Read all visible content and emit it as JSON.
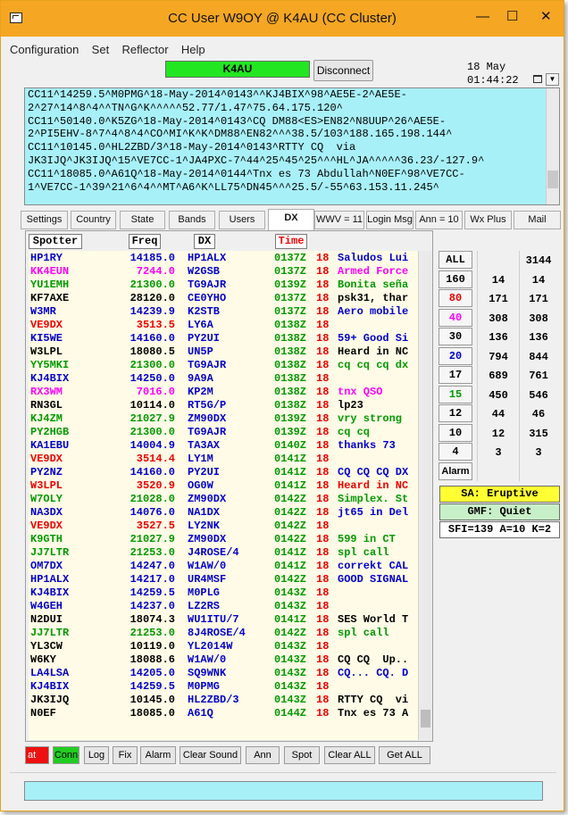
{
  "window": {
    "title": "CC User W9OY @ K4AU  (CC Cluster)",
    "controls": {
      "minimize": "—",
      "maximize": "☐",
      "close": "✕"
    }
  },
  "menu": [
    "Configuration",
    "Set",
    "Reflector",
    "Help"
  ],
  "cluster": {
    "node": "K4AU",
    "node_color": "#22e622",
    "disconnect_label": "Disconnect",
    "date": "18 May",
    "time": "01:44:22"
  },
  "raw_lines": [
    "CC11^14259.5^M0PMG^18-May-2014^0143^^KJ4BIX^98^AE5E-2^AE5E-",
    "2^27^14^8^4^^TN^G^K^^^^^52.77/1.47^75.64.175.120^",
    "CC11^50140.0^K5ZG^18-May-2014^0143^CQ DM88<ES>EN82^N8UUP^26^AE5E-",
    "2^PI5EHV-8^7^4^8^4^CO^MI^K^K^DM88^EN82^^^38.5/103^188.165.198.144^",
    "CC11^10145.0^HL2ZBD/3^18-May-2014^0143^RTTY CQ  via",
    "JK3IJQ^JK3IJQ^15^VE7CC-1^JA4PXC-7^44^25^45^25^^^HL^JA^^^^^36.23/-127.9^",
    "CC11^18085.0^A61Q^18-May-2014^0144^Tnx es 73 Abdullah^N0EF^98^VE7CC-",
    "1^VE7CC-1^39^21^6^4^^MT^A6^K^LL75^DN45^^^25.5/-55^63.153.11.245^"
  ],
  "tabs": [
    "Settings",
    "Country",
    "State",
    "Bands",
    "Users",
    "DX",
    "WWV = 11",
    "Login Msg",
    "Ann = 10",
    "Wx Plus",
    "Mail"
  ],
  "active_tab": "DX",
  "columns": {
    "spotter": "Spotter",
    "freq": "Freq",
    "dx": "DX",
    "time": "Time"
  },
  "spots": [
    {
      "spotter": "HP1RY",
      "freq": "14185.0",
      "dx": "HP1ALX",
      "time": "0137Z",
      "day": "18",
      "comment": "Saludos Lui",
      "color": "#0000cc"
    },
    {
      "spotter": "KK4EUN",
      "freq": "7244.0",
      "dx": "W2GSB",
      "time": "0137Z",
      "day": "18",
      "comment": "Armed Force",
      "color": "#ff00ff"
    },
    {
      "spotter": "YU1EMH",
      "freq": "21300.0",
      "dx": "TG9AJR",
      "time": "0139Z",
      "day": "18",
      "comment": "Bonita seña",
      "color": "#009900"
    },
    {
      "spotter": "KF7AXE",
      "freq": "28120.0",
      "dx": "CE0YHO",
      "time": "0137Z",
      "day": "18",
      "comment": "psk31, thar",
      "color": "#000000"
    },
    {
      "spotter": "W3MR",
      "freq": "14239.9",
      "dx": "K2STB",
      "time": "0137Z",
      "day": "18",
      "comment": "Aero mobile",
      "color": "#0000cc"
    },
    {
      "spotter": "VE9DX",
      "freq": "3513.5",
      "dx": "LY6A",
      "time": "0138Z",
      "day": "18",
      "comment": "",
      "color": "#ee0000"
    },
    {
      "spotter": "KI5WE",
      "freq": "14160.0",
      "dx": "PY2UI",
      "time": "0138Z",
      "day": "18",
      "comment": "59+ Good Si",
      "color": "#0000cc"
    },
    {
      "spotter": "W3LPL",
      "freq": "18080.5",
      "dx": "UN5P",
      "time": "0138Z",
      "day": "18",
      "comment": "Heard in NC",
      "color": "#000000"
    },
    {
      "spotter": "YY5MKI",
      "freq": "21300.0",
      "dx": "TG9AJR",
      "time": "0138Z",
      "day": "18",
      "comment": "cq cq cq dx",
      "color": "#009900"
    },
    {
      "spotter": "KJ4BIX",
      "freq": "14250.0",
      "dx": "9A9A",
      "time": "0138Z",
      "day": "18",
      "comment": "",
      "color": "#0000cc"
    },
    {
      "spotter": "RX3WM",
      "freq": "7016.0",
      "dx": "KP2M",
      "time": "0138Z",
      "day": "18",
      "comment": "tnx QSO",
      "color": "#ff00ff"
    },
    {
      "spotter": "RN3GL",
      "freq": "10114.0",
      "dx": "RT5G/P",
      "time": "0138Z",
      "day": "18",
      "comment": "lp23",
      "color": "#000000"
    },
    {
      "spotter": "KJ4ZM",
      "freq": "21027.9",
      "dx": "ZM90DX",
      "time": "0139Z",
      "day": "18",
      "comment": "vry strong",
      "color": "#009900"
    },
    {
      "spotter": "PY2HGB",
      "freq": "21300.0",
      "dx": "TG9AJR",
      "time": "0139Z",
      "day": "18",
      "comment": "cq cq",
      "color": "#009900"
    },
    {
      "spotter": "KA1EBU",
      "freq": "14004.9",
      "dx": "TA3AX",
      "time": "0140Z",
      "day": "18",
      "comment": "thanks 73",
      "color": "#0000cc"
    },
    {
      "spotter": "VE9DX",
      "freq": "3514.4",
      "dx": "LY1M",
      "time": "0141Z",
      "day": "18",
      "comment": "",
      "color": "#ee0000"
    },
    {
      "spotter": "PY2NZ",
      "freq": "14160.0",
      "dx": "PY2UI",
      "time": "0141Z",
      "day": "18",
      "comment": "CQ CQ CQ DX",
      "color": "#0000cc"
    },
    {
      "spotter": "W3LPL",
      "freq": "3520.9",
      "dx": "OG0W",
      "time": "0141Z",
      "day": "18",
      "comment": "Heard in NC",
      "color": "#ee0000"
    },
    {
      "spotter": "W7OLY",
      "freq": "21028.0",
      "dx": "ZM90DX",
      "time": "0142Z",
      "day": "18",
      "comment": "Simplex. St",
      "color": "#009900"
    },
    {
      "spotter": "NA3DX",
      "freq": "14076.0",
      "dx": "NA1DX",
      "time": "0142Z",
      "day": "18",
      "comment": "jt65 in Del",
      "color": "#0000cc"
    },
    {
      "spotter": "VE9DX",
      "freq": "3527.5",
      "dx": "LY2NK",
      "time": "0142Z",
      "day": "18",
      "comment": "",
      "color": "#ee0000"
    },
    {
      "spotter": "K9GTH",
      "freq": "21027.9",
      "dx": "ZM90DX",
      "time": "0142Z",
      "day": "18",
      "comment": "599 in CT",
      "color": "#009900"
    },
    {
      "spotter": "JJ7LTR",
      "freq": "21253.0",
      "dx": "J4ROSE/4",
      "time": "0141Z",
      "day": "18",
      "comment": "spl call",
      "color": "#009900"
    },
    {
      "spotter": "OM7DX",
      "freq": "14247.0",
      "dx": "W1AW/0",
      "time": "0141Z",
      "day": "18",
      "comment": "correkt CAL",
      "color": "#0000cc"
    },
    {
      "spotter": "HP1ALX",
      "freq": "14217.0",
      "dx": "UR4MSF",
      "time": "0142Z",
      "day": "18",
      "comment": "GOOD SIGNAL",
      "color": "#0000cc"
    },
    {
      "spotter": "KJ4BIX",
      "freq": "14259.5",
      "dx": "M0PLG",
      "time": "0143Z",
      "day": "18",
      "comment": "",
      "color": "#0000cc"
    },
    {
      "spotter": "W4GEH",
      "freq": "14237.0",
      "dx": "LZ2RS",
      "time": "0143Z",
      "day": "18",
      "comment": "",
      "color": "#0000cc"
    },
    {
      "spotter": "N2DUI",
      "freq": "18074.3",
      "dx": "WU1ITU/7",
      "time": "0141Z",
      "day": "18",
      "comment": "SES World T",
      "color": "#000000"
    },
    {
      "spotter": "JJ7LTR",
      "freq": "21253.0",
      "dx": "8J4ROSE/4",
      "time": "0142Z",
      "day": "18",
      "comment": "spl call",
      "color": "#009900"
    },
    {
      "spotter": "YL3CW",
      "freq": "10119.0",
      "dx": "YL2014W",
      "time": "0143Z",
      "day": "18",
      "comment": "",
      "color": "#000000"
    },
    {
      "spotter": "W6KY",
      "freq": "18088.6",
      "dx": "W1AW/0",
      "time": "0143Z",
      "day": "18",
      "comment": "CQ CQ  Up..",
      "color": "#000000"
    },
    {
      "spotter": "LA4LSA",
      "freq": "14205.0",
      "dx": "SQ9WNK",
      "time": "0143Z",
      "day": "18",
      "comment": "CQ... CQ. D",
      "color": "#0000cc"
    },
    {
      "spotter": "KJ4BIX",
      "freq": "14259.5",
      "dx": "M0PMG",
      "time": "0143Z",
      "day": "18",
      "comment": "",
      "color": "#0000cc"
    },
    {
      "spotter": "JK3IJQ",
      "freq": "10145.0",
      "dx": "HL2ZBD/3",
      "time": "0143Z",
      "day": "18",
      "comment": "RTTY CQ  vi",
      "color": "#000000"
    },
    {
      "spotter": "N0EF",
      "freq": "18085.0",
      "dx": "A61Q",
      "time": "0144Z",
      "day": "18",
      "comment": "Tnx es 73 A",
      "color": "#000000"
    }
  ],
  "bands": [
    {
      "label": "ALL",
      "a": "",
      "b": "3144",
      "color": "#000000"
    },
    {
      "label": "160",
      "a": "14",
      "b": "14",
      "color": "#000000"
    },
    {
      "label": "80",
      "a": "171",
      "b": "171",
      "color": "#ee0000"
    },
    {
      "label": "40",
      "a": "308",
      "b": "308",
      "color": "#ff00ff"
    },
    {
      "label": "30",
      "a": "136",
      "b": "136",
      "color": "#000000"
    },
    {
      "label": "20",
      "a": "794",
      "b": "844",
      "color": "#0000cc"
    },
    {
      "label": "17",
      "a": "689",
      "b": "761",
      "color": "#000000"
    },
    {
      "label": "15",
      "a": "450",
      "b": "546",
      "color": "#009900"
    },
    {
      "label": "12",
      "a": "44",
      "b": "46",
      "color": "#000000"
    },
    {
      "label": "10",
      "a": "12",
      "b": "315",
      "color": "#000000"
    },
    {
      "label": "4",
      "a": "3",
      "b": "3",
      "color": "#000000"
    },
    {
      "label": "Alarm",
      "a": "",
      "b": "",
      "color": "#000000"
    }
  ],
  "propagation": {
    "sa": "SA: Eruptive",
    "sa_color": "#ffff33",
    "gmf": "GMF: Quiet",
    "gmf_color": "#c8f0c8",
    "indices": "SFI=139 A=10 K=2"
  },
  "buttons": {
    "at": "at",
    "conn": "Conn",
    "log": "Log",
    "fix": "Fix",
    "alarm": "Alarm",
    "clear_sound": "Clear Sound",
    "ann": "Ann",
    "spot": "Spot",
    "clear_all": "Clear ALL",
    "get_all": "Get ALL"
  },
  "colors": {
    "title_bar": "#f5a623",
    "raw_area": "#a8f0f8",
    "spot_list_bg": "#fffbe6",
    "at_button": "#ee1111",
    "conn_button": "#22cc22"
  }
}
